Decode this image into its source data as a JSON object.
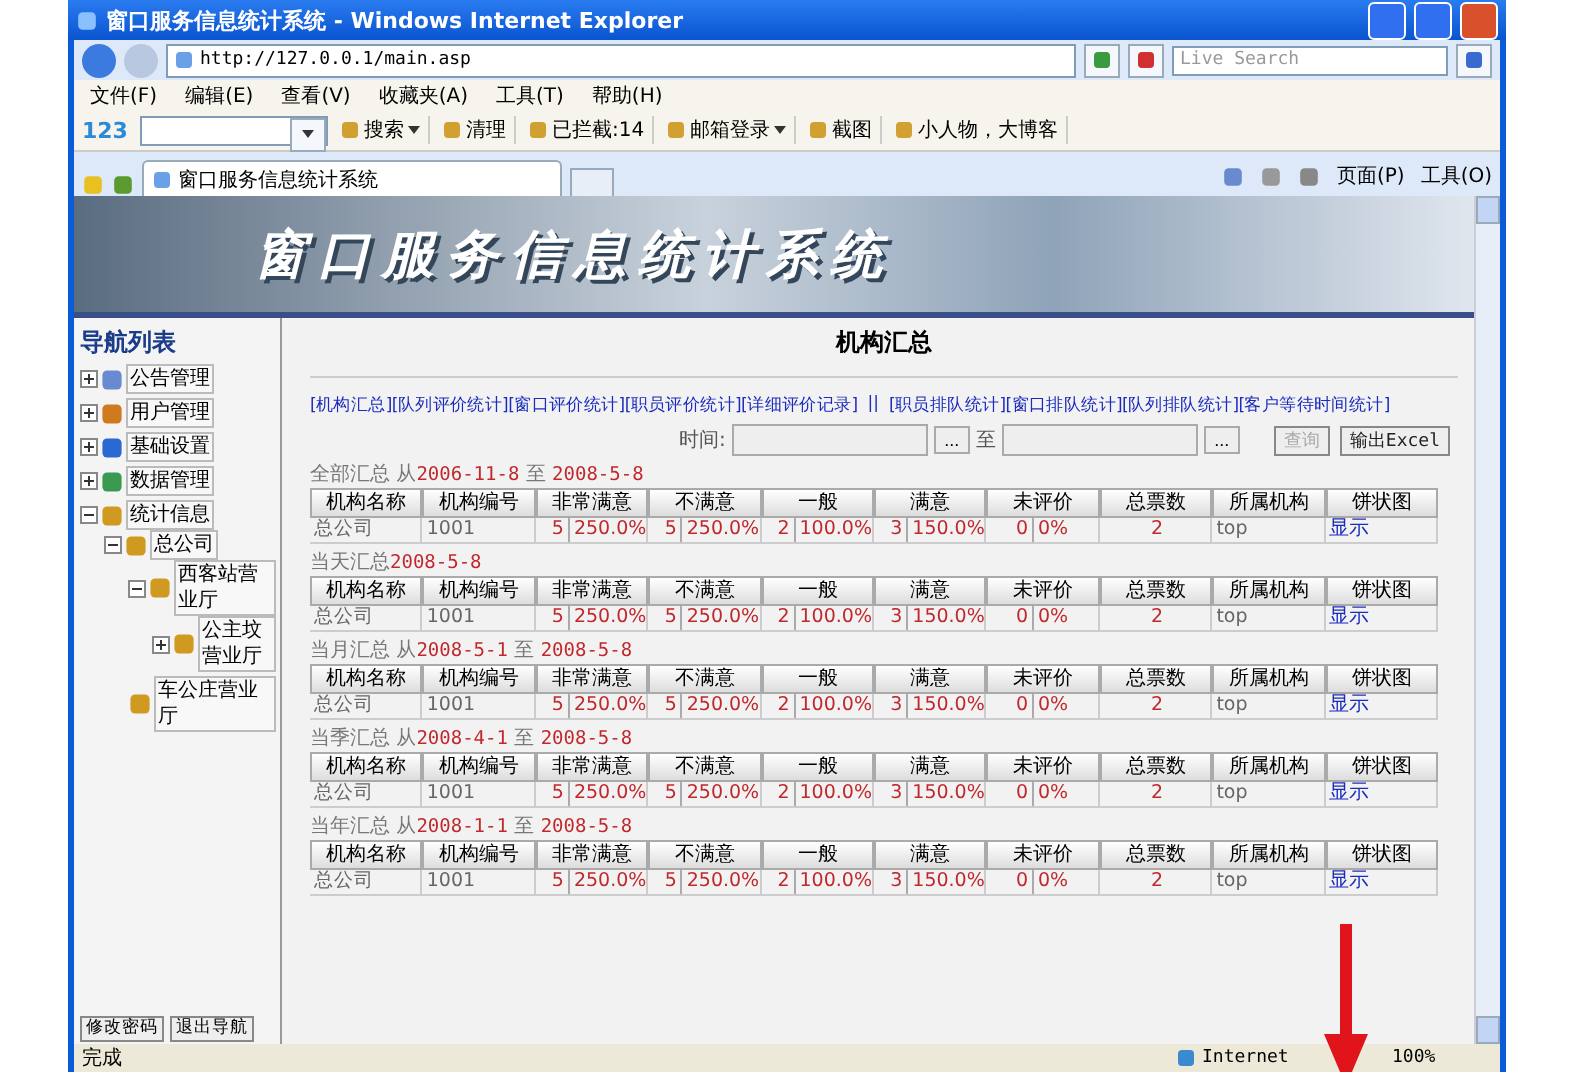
{
  "window": {
    "title": "窗口服务信息统计系统 - Windows Internet Explorer"
  },
  "address": {
    "url": "http://127.0.0.1/main.asp",
    "search_placeholder": "Live Search"
  },
  "menu": [
    "文件(F)",
    "编辑(E)",
    "查看(V)",
    "收藏夹(A)",
    "工具(T)",
    "帮助(H)"
  ],
  "toolbar": {
    "logo": "123",
    "items": [
      {
        "label": "搜索",
        "dropdown": true
      },
      {
        "label": "清理",
        "dropdown": false
      },
      {
        "label": "已拦截:14",
        "dropdown": false
      },
      {
        "label": "邮箱登录",
        "dropdown": true
      },
      {
        "label": "截图",
        "dropdown": false
      },
      {
        "label": "小人物，大博客",
        "dropdown": false
      }
    ]
  },
  "tab": {
    "label": "窗口服务信息统计系统"
  },
  "command_bar": [
    "页面(P)",
    "工具(O)"
  ],
  "banner": {
    "title": "窗口服务信息统计系统"
  },
  "nav": {
    "title": "导航列表",
    "items": [
      {
        "label": "公告管理",
        "expanded": false
      },
      {
        "label": "用户管理",
        "expanded": false
      },
      {
        "label": "基础设置",
        "expanded": false
      },
      {
        "label": "数据管理",
        "expanded": false
      },
      {
        "label": "统计信息",
        "expanded": true,
        "children": [
          {
            "label": "总公司",
            "expanded": true,
            "children": [
              {
                "label": "西客站营业厅",
                "expanded": true,
                "children": [
                  {
                    "label": "公主坟营业厅",
                    "expanded": false
                  }
                ]
              },
              {
                "label": "车公庄营业厅"
              }
            ]
          }
        ]
      }
    ],
    "buttons": [
      "修改密码",
      "退出导航"
    ]
  },
  "main": {
    "title": "机构汇总",
    "links_left": [
      "[机构汇总]",
      "[队列评价统计]",
      "[窗口评价统计]",
      "[职员评价统计]",
      "[详细评价记录]"
    ],
    "separator": "||",
    "links_right": [
      "[职员排队统计]",
      "[窗口排队统计]",
      "[队列排队统计]",
      "[客户等待时间统计]"
    ],
    "time": {
      "label": "时间:",
      "picker": "...",
      "picker_2": "...",
      "to": "至",
      "query": {
        "label": "查询",
        "disabled": true
      },
      "export": "输出Excel"
    },
    "sections": [
      {
        "label": "全部汇总 从",
        "start": "2006-11-8",
        "to": "至",
        "end": "2008-5-8",
        "columns": [
          "机构名称",
          "机构编号",
          "非常满意",
          "不满意",
          "一般",
          "满意",
          "未评价",
          "总票数",
          "所属机构",
          "饼状图"
        ],
        "row": [
          {
            "kind": "text",
            "value": "总公司"
          },
          {
            "kind": "text",
            "value": "1001"
          },
          {
            "kind": "pair",
            "count": "5",
            "percent": "250.0%"
          },
          {
            "kind": "pair",
            "count": "5",
            "percent": "250.0%"
          },
          {
            "kind": "pair",
            "count": "2",
            "percent": "100.0%"
          },
          {
            "kind": "pair",
            "count": "3",
            "percent": "150.0%"
          },
          {
            "kind": "pair",
            "count": "0",
            "percent": "0%"
          },
          {
            "kind": "number",
            "value": "2"
          },
          {
            "kind": "text",
            "value": "top"
          },
          {
            "kind": "link",
            "value": "显示"
          }
        ]
      },
      {
        "label": "当天汇总",
        "start": "2008-5-8",
        "columns": [
          "机构名称",
          "机构编号",
          "非常满意",
          "不满意",
          "一般",
          "满意",
          "未评价",
          "总票数",
          "所属机构",
          "饼状图"
        ],
        "row": [
          {
            "kind": "text",
            "value": "总公司"
          },
          {
            "kind": "text",
            "value": "1001"
          },
          {
            "kind": "pair",
            "count": "5",
            "percent": "250.0%"
          },
          {
            "kind": "pair",
            "count": "5",
            "percent": "250.0%"
          },
          {
            "kind": "pair",
            "count": "2",
            "percent": "100.0%"
          },
          {
            "kind": "pair",
            "count": "3",
            "percent": "150.0%"
          },
          {
            "kind": "pair",
            "count": "0",
            "percent": "0%"
          },
          {
            "kind": "number",
            "value": "2"
          },
          {
            "kind": "text",
            "value": "top"
          },
          {
            "kind": "link",
            "value": "显示"
          }
        ]
      },
      {
        "label": "当月汇总 从",
        "start": "2008-5-1",
        "to": "至",
        "end": "2008-5-8",
        "columns": [
          "机构名称",
          "机构编号",
          "非常满意",
          "不满意",
          "一般",
          "满意",
          "未评价",
          "总票数",
          "所属机构",
          "饼状图"
        ],
        "row": [
          {
            "kind": "text",
            "value": "总公司"
          },
          {
            "kind": "text",
            "value": "1001"
          },
          {
            "kind": "pair",
            "count": "5",
            "percent": "250.0%"
          },
          {
            "kind": "pair",
            "count": "5",
            "percent": "250.0%"
          },
          {
            "kind": "pair",
            "count": "2",
            "percent": "100.0%"
          },
          {
            "kind": "pair",
            "count": "3",
            "percent": "150.0%"
          },
          {
            "kind": "pair",
            "count": "0",
            "percent": "0%"
          },
          {
            "kind": "number",
            "value": "2"
          },
          {
            "kind": "text",
            "value": "top"
          },
          {
            "kind": "link",
            "value": "显示"
          }
        ]
      },
      {
        "label": "当季汇总 从",
        "start": "2008-4-1",
        "to": "至",
        "end": "2008-5-8",
        "columns": [
          "机构名称",
          "机构编号",
          "非常满意",
          "不满意",
          "一般",
          "满意",
          "未评价",
          "总票数",
          "所属机构",
          "饼状图"
        ],
        "row": [
          {
            "kind": "text",
            "value": "总公司"
          },
          {
            "kind": "text",
            "value": "1001"
          },
          {
            "kind": "pair",
            "count": "5",
            "percent": "250.0%"
          },
          {
            "kind": "pair",
            "count": "5",
            "percent": "250.0%"
          },
          {
            "kind": "pair",
            "count": "2",
            "percent": "100.0%"
          },
          {
            "kind": "pair",
            "count": "3",
            "percent": "150.0%"
          },
          {
            "kind": "pair",
            "count": "0",
            "percent": "0%"
          },
          {
            "kind": "number",
            "value": "2"
          },
          {
            "kind": "text",
            "value": "top"
          },
          {
            "kind": "link",
            "value": "显示"
          }
        ]
      },
      {
        "label": "当年汇总 从",
        "start": "2008-1-1",
        "to": "至",
        "end": "2008-5-8",
        "columns": [
          "机构名称",
          "机构编号",
          "非常满意",
          "不满意",
          "一般",
          "满意",
          "未评价",
          "总票数",
          "所属机构",
          "饼状图"
        ],
        "row": [
          {
            "kind": "text",
            "value": "总公司"
          },
          {
            "kind": "text",
            "value": "1001"
          },
          {
            "kind": "pair",
            "count": "5",
            "percent": "250.0%"
          },
          {
            "kind": "pair",
            "count": "5",
            "percent": "250.0%"
          },
          {
            "kind": "pair",
            "count": "2",
            "percent": "100.0%"
          },
          {
            "kind": "pair",
            "count": "3",
            "percent": "150.0%"
          },
          {
            "kind": "pair",
            "count": "0",
            "percent": "0%"
          },
          {
            "kind": "number",
            "value": "2"
          },
          {
            "kind": "text",
            "value": "top"
          },
          {
            "kind": "link",
            "value": "显示"
          }
        ]
      }
    ]
  },
  "status": {
    "text": "完成",
    "zone": "Internet",
    "zoom": "100%"
  }
}
